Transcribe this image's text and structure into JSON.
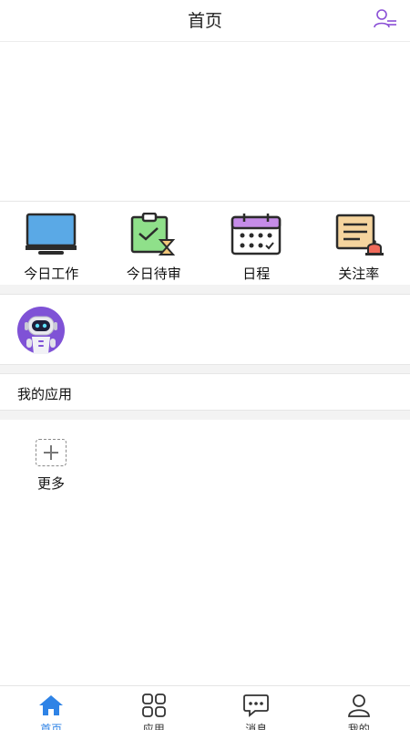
{
  "header": {
    "title": "首页"
  },
  "quick_actions": [
    {
      "label": "今日工作",
      "icon": "monitor-icon"
    },
    {
      "label": "今日待审",
      "icon": "clipboard-check-hourglass-icon"
    },
    {
      "label": "日程",
      "icon": "calendar-icon"
    },
    {
      "label": "关注率",
      "icon": "document-bell-icon"
    }
  ],
  "assistant": {
    "icon": "robot-avatar-icon"
  },
  "my_apps": {
    "title": "我的应用",
    "more_label": "更多"
  },
  "tabbar": {
    "items": [
      {
        "label": "首页",
        "icon": "home-icon",
        "active": true
      },
      {
        "label": "应用",
        "icon": "grid-icon",
        "active": false
      },
      {
        "label": "消息",
        "icon": "chat-bubble-icon",
        "active": false
      },
      {
        "label": "我的",
        "icon": "person-icon",
        "active": false
      }
    ]
  },
  "colors": {
    "accent": "#2f83e6",
    "divider": "#e6e6e6",
    "gap": "#f3f3f3"
  }
}
